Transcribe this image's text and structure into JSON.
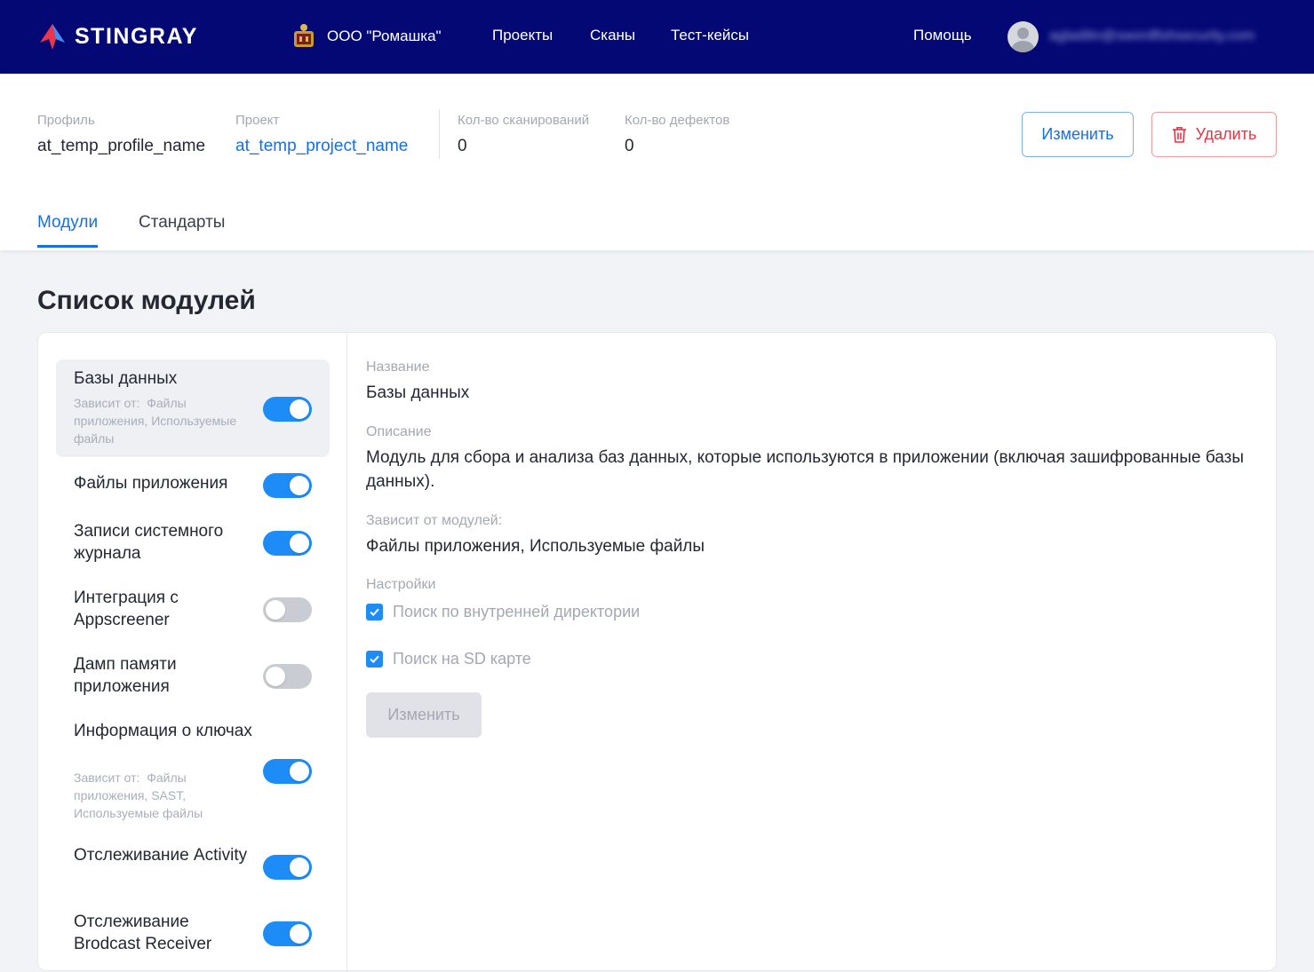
{
  "navbar": {
    "brand": "STINGRAY",
    "organization": "ООО \"Ромашка\"",
    "links": [
      "Проекты",
      "Сканы",
      "Тест-кейсы"
    ],
    "help": "Помощь",
    "user_email": "agladilin@swordfishsecurity.com",
    "colors": {
      "background": "#030875",
      "text": "#ffffff"
    }
  },
  "header": {
    "profile": {
      "label": "Профиль",
      "value": "at_temp_profile_name"
    },
    "project": {
      "label": "Проект",
      "value": "at_temp_project_name"
    },
    "scans": {
      "label": "Кол-во сканирований",
      "value": "0"
    },
    "defects": {
      "label": "Кол-во дефектов",
      "value": "0"
    },
    "edit_label": "Изменить",
    "delete_label": "Удалить",
    "delete_icon": "trash-icon"
  },
  "tabs": [
    {
      "label": "Модули",
      "active": true
    },
    {
      "label": "Стандарты",
      "active": false
    }
  ],
  "section_title": "Список модулей",
  "modules": [
    {
      "name": "Базы данных",
      "depends_label": "Зависит от:",
      "depends": "Файлы приложения, Используемые файлы",
      "enabled": true,
      "selected": true
    },
    {
      "name": "Файлы приложения",
      "enabled": true
    },
    {
      "name": "Записи системного журнала",
      "enabled": true
    },
    {
      "name": "Интеграция с Appscreener",
      "enabled": false
    },
    {
      "name": "Дамп памяти приложения",
      "enabled": false
    },
    {
      "name": "Информация о ключах",
      "depends_label": "Зависит от:",
      "depends": "Файлы приложения, SAST, Используемые файлы",
      "enabled": true
    },
    {
      "name": "Отслеживание Activity",
      "enabled": true
    },
    {
      "name": "Отслеживание Brodcast Receiver",
      "enabled": true
    }
  ],
  "details": {
    "name_label": "Название",
    "name": "Базы данных",
    "description_label": "Описание",
    "description": "Модуль для сбора и анализа баз данных, которые используются в приложении (включая зашифрованные базы данных).",
    "depends_label": "Зависит от модулей:",
    "depends": "Файлы приложения, Используемые файлы",
    "settings_label": "Настройки",
    "settings": [
      {
        "label": "Поиск по внутренней директории",
        "checked": true
      },
      {
        "label": "Поиск на SD карте",
        "checked": true
      }
    ],
    "submit_label": "Изменить"
  },
  "colors": {
    "accent": "#1670e4",
    "toggle_on": "#1e8cf6",
    "danger": "#e23744"
  }
}
